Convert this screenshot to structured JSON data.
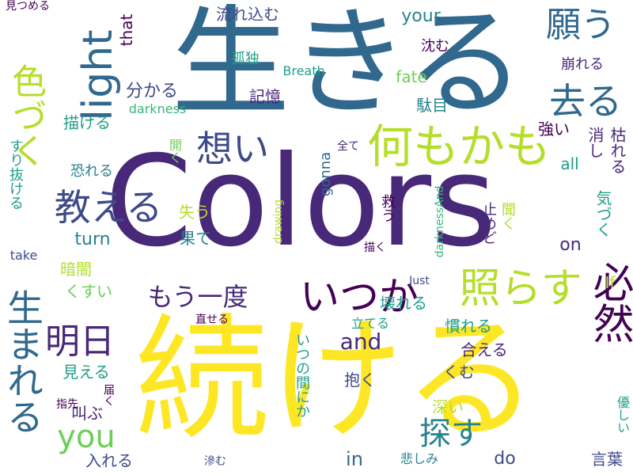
{
  "words": [
    "Colors",
    "続ける",
    "生きる",
    "何もかも",
    "教える",
    "想い",
    "いつか",
    "もう一度",
    "照らす",
    "light",
    "色づく",
    "去る",
    "願う",
    "明日",
    "生まれる",
    "必然",
    "探す",
    "you",
    "and",
    "in",
    "do",
    "on",
    "turn",
    "take",
    "If",
    "Just",
    "all",
    "that",
    "your",
    "fate",
    "Breath",
    "darkness",
    "darknessAnd",
    "drawing",
    "gonna",
    "流れ込む",
    "沈む",
    "孤独",
    "記憶",
    "分かる",
    "描ける",
    "崩れる",
    "駄目",
    "強い",
    "消し",
    "枯れる",
    "全て",
    "開く",
    "恐れる",
    "失う",
    "果て",
    "救う",
    "止めど",
    "描く",
    "聞く",
    "気づく",
    "暗闇",
    "くすい",
    "すり抜ける",
    "壊れる",
    "立てる",
    "慣れる",
    "合える",
    "いつの間にか",
    "抱く",
    "くむ",
    "見える",
    "直せる",
    "叫ぶ",
    "届く",
    "深い",
    "指先",
    "入れる",
    "滲む",
    "悲しみ",
    "言葉",
    "優しい",
    "見つめる"
  ]
}
